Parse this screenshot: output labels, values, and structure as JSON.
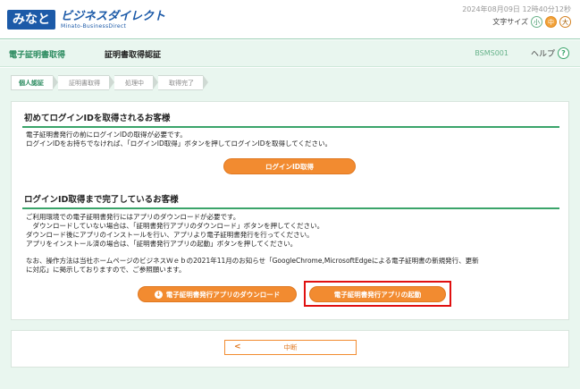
{
  "header": {
    "logo_mark": "みなと",
    "logo_main": "ビジネスダイレクト",
    "logo_sub": "Minato-BusinessDirect",
    "datetime": "2024年08月09日 12時40分12秒",
    "fontsize_label": "文字サイズ",
    "fontsize_small": "小",
    "fontsize_medium": "中",
    "fontsize_large": "大"
  },
  "titlebar": {
    "category": "電子証明書取得",
    "title": "証明書取得認証",
    "screen_code": "BSMS001",
    "help_label": "ヘルプ",
    "help_icon": "?"
  },
  "steps": [
    "個人認証",
    "証明書取得",
    "処理中",
    "取得完了"
  ],
  "section1": {
    "title": "初めてログインIDを取得されるお客様",
    "line1": "電子証明書発行の前にログインIDの取得が必要です。",
    "line2": "ログインIDをお持ちでなければ、「ログインID取得」ボタンを押してログインIDを取得してください。",
    "button": "ログインID取得"
  },
  "section2": {
    "title": "ログインID取得まで完了しているお客様",
    "line1": "ご利用環境での電子証明書発行にはアプリのダウンロードが必要です。",
    "line2": "　ダウンロードしていない場合は、「証明書発行アプリのダウンロード」ボタンを押してください。",
    "line3": "ダウンロード後にアプリのインストールを行い、アプリより電子証明書発行を行ってください。",
    "line4": "アプリをインストール済の場合は、「証明書発行アプリの起動」ボタンを押してください。",
    "note1": "なお、操作方法は当社ホームページのビジネスＷｅｂの2021年11月のお知らせ「GoogleChrome,MicrosoftEdgeによる電子証明書の新規発行、更新",
    "note2": "に対応」に掲示しておりますので、ご参照願います。",
    "download_button": "電子証明書発行アプリのダウンロード",
    "launch_button": "電子証明書発行アプリの起動"
  },
  "footer": {
    "back_button": "中断"
  },
  "colors": {
    "accent_green": "#3aa46a",
    "button_orange": "#f28b30",
    "highlight_red": "#e01010",
    "brand_blue": "#1c5aa8"
  }
}
